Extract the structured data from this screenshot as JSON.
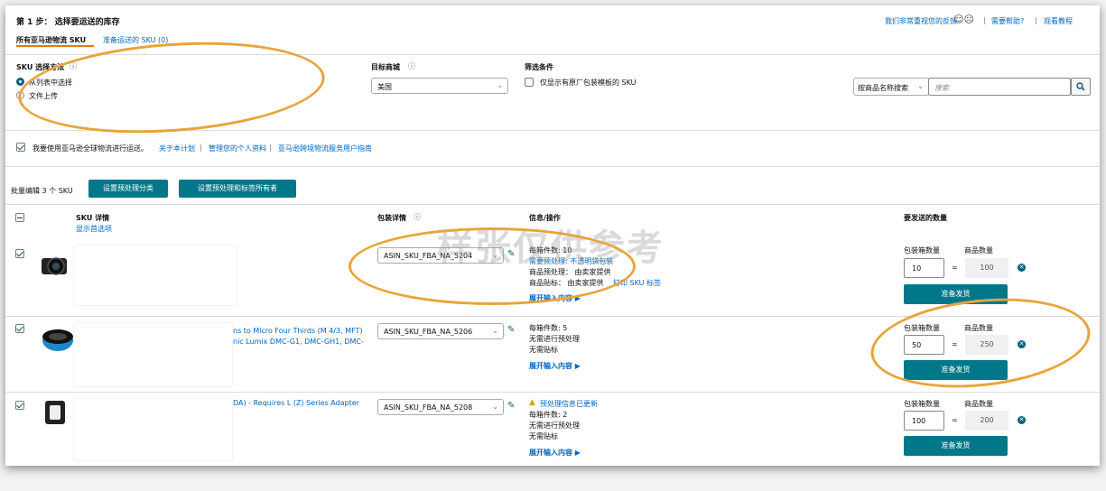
{
  "header": {
    "step_title": "第 1 步： 选择要运送的库存",
    "tabs": [
      "所有亚马逊物流 SKU",
      "准备运送的 SKU (0)"
    ],
    "feedback_text": "我们非常重视您的反馈",
    "help_link": "需要帮助?",
    "tutorial_link": "观看教程",
    "separator": "|"
  },
  "filters": {
    "sku_method_label": "SKU 选择方法",
    "radio_list": "从列表中选择",
    "radio_upload": "文件上传",
    "marketplace_label": "目标商城",
    "marketplace_value": "美国",
    "conditions_label": "筛选条件",
    "conditions_checkbox": "仅显示有原厂包装模板的 SKU",
    "search_type": "按商品名称搜索",
    "search_placeholder": "搜索"
  },
  "global_program": {
    "text": "我要使用亚马逊全球物流进行运送。",
    "about": "关于本计划",
    "manage": "管理您的个人资料",
    "guide": "亚马逊跨境物流服务用户指南"
  },
  "bulk": {
    "label": "批量编辑 3 个 SKU",
    "prep_category_btn": "设置预处理分类",
    "prep_owner_btn": "设置预处理和标签所有者"
  },
  "table_header": {
    "sku_details": "SKU 详情",
    "show_preferred": "显示首选项",
    "packing_details": "包装详情",
    "info_actions": "信息/操作",
    "qty_to_send": "要发送的数量"
  },
  "rows": [
    {
      "title_fragment_1": "",
      "title_fragment_2": "",
      "packing_value": "ASIN_SKU_FBA_NA_5204",
      "info_lines": [
        "每箱件数: 10",
        "需要预处理: 不透明袋包装",
        "商品预处理： 由卖家提供",
        "商品贴标： 由卖家提供"
      ],
      "print_label": "打印 SKU 标签",
      "expand": "展开输入内容",
      "box_qty_label": "包装箱数量",
      "unit_qty_label": "商品数量",
      "box_qty": "10",
      "unit_qty": "100",
      "ready_btn": "准备发货"
    },
    {
      "title_fragment_1": "ns to Micro Four Thirds (M 4/3, MFT)",
      "title_fragment_2": "nic Lumix DMC-G1, DMC-GH1, DMC-",
      "packing_value": "ASIN_SKU_FBA_NA_5206",
      "info_lines": [
        "每箱件数: 5",
        "无需进行预处理",
        "无需贴标"
      ],
      "expand": "展开输入内容",
      "box_qty_label": "包装箱数量",
      "unit_qty_label": "商品数量",
      "box_qty": "50",
      "unit_qty": "250",
      "ready_btn": "准备发货"
    },
    {
      "title_fragment_1": "DA) - Requires L (Z) Series Adapter",
      "title_fragment_2": "",
      "packing_value": "ASIN_SKU_FBA_NA_5208",
      "warning": "预处理信息已更新",
      "info_lines": [
        "每箱件数: 2",
        "无需进行预处理",
        "无需贴标"
      ],
      "expand": "展开输入内容",
      "box_qty_label": "包装箱数量",
      "unit_qty_label": "商品数量",
      "box_qty": "100",
      "unit_qty": "200",
      "ready_btn": "准备发货"
    }
  ],
  "equals": "=",
  "watermark": "样张仅供参考",
  "icons": {
    "info": "info-circle-icon",
    "chevron": "chevron-down-icon",
    "search": "search-icon",
    "pencil": "pencil-icon",
    "remove": "remove-circle-icon",
    "expand": "triangle-right-icon",
    "warning": "warning-icon"
  },
  "colors": {
    "teal": "#00788a",
    "link": "#0066c0",
    "annotation": "#e8a43a"
  }
}
